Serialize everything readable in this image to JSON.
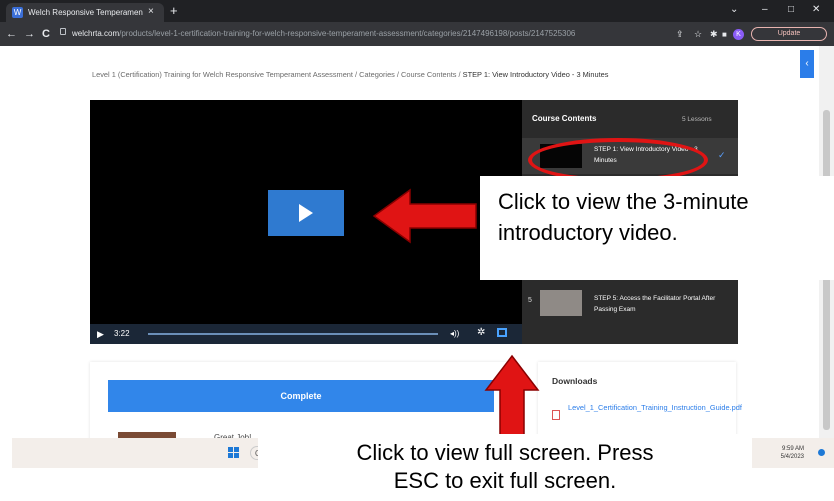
{
  "browser": {
    "tab_title": "Welch Responsive Temperament",
    "tab_close": "×",
    "new_tab": "+",
    "url_domain": "welchrta.com",
    "url_path": "/products/level-1-certification-training-for-welch-responsive-temperament-assessment/categories/2147496198/posts/2147525306",
    "update_label": "Update",
    "profile_initial": "K",
    "window_controls": [
      "⌄",
      "–",
      "□",
      "✕"
    ],
    "nav_back": "←",
    "nav_forward": "→",
    "nav_reload": "C"
  },
  "page": {
    "breadcrumb_path": "Level 1 (Certification) Training for Welch Responsive Temperament Assessment / Categories / Course Contents / ",
    "breadcrumb_current": "STEP 1: View Introductory Video - 3 Minutes",
    "side_tab_icon": "‹"
  },
  "player": {
    "current_time": "3:22",
    "progress_fraction": 0.0,
    "icons": [
      "play-icon",
      "volume-icon",
      "gear-icon",
      "fullscreen-icon"
    ]
  },
  "course": {
    "title": "Course Contents",
    "count": "5 Lessons",
    "lesson1_text": "STEP 1: View Introductory Video - 3 Minutes",
    "lesson5_number": "5",
    "lesson5_text": "STEP 5: Access the Facilitator Portal After Passing Exam"
  },
  "complete": {
    "button_label": "Complete",
    "great_job_text": "Great Job!"
  },
  "downloads": {
    "title": "Downloads",
    "file_link": "Level_1_Certification_Training_Instruction_Guide.pdf"
  },
  "taskbar": {
    "time": "9:59 AM",
    "date": "5/4/2023"
  },
  "annotations": {
    "callout_video": "Click to view the 3-minute introductory video.",
    "callout_fullscreen_line1": "Click to view full screen. Press",
    "callout_fullscreen_line2": "ESC to exit full screen."
  },
  "colors": {
    "accent_blue": "#3186ea",
    "annotation_red": "#e01414",
    "sidebar_bg": "#2b2b2b"
  }
}
